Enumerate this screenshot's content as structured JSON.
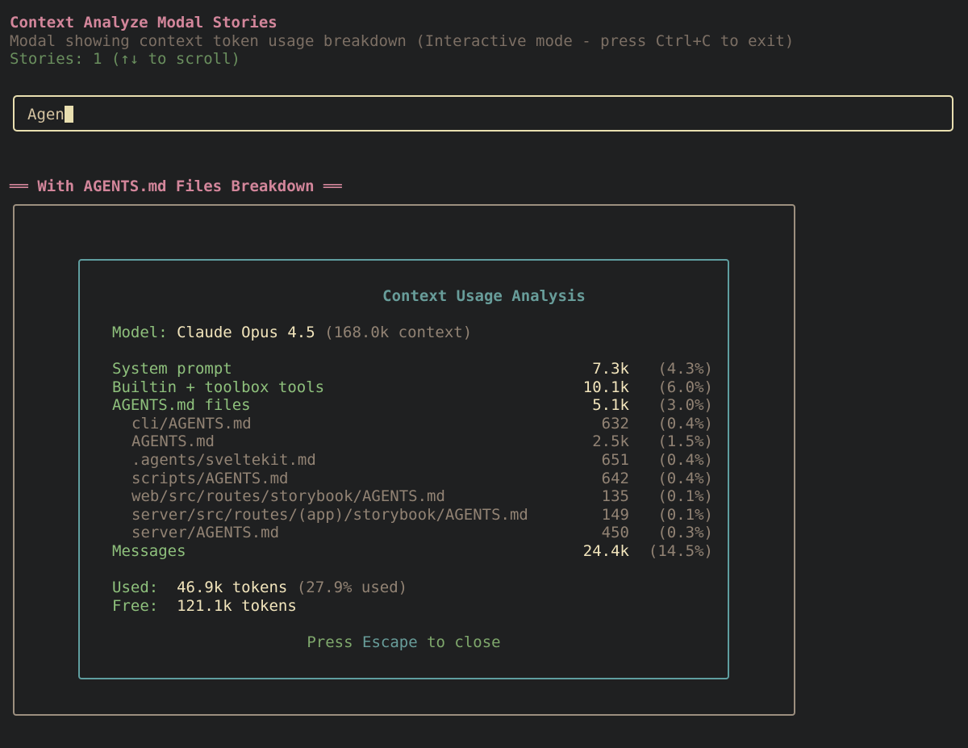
{
  "header": {
    "title": "Context Analyze Modal Stories",
    "subtitle": "Modal showing context token usage breakdown (Interactive mode - press Ctrl+C to exit)",
    "stories_line": "Stories: 1 (↑↓ to scroll)"
  },
  "search": {
    "value": "Agen"
  },
  "section": {
    "left_bars": "══",
    "title": "With AGENTS.md Files Breakdown",
    "right_bars": "══"
  },
  "modal": {
    "title": "Context Usage Analysis",
    "model_label": "Model:",
    "model_name": "Claude Opus 4.5",
    "model_context": "(168.0k context)",
    "rows": [
      {
        "label": "System prompt",
        "value": "7.3k",
        "pct": "(4.3%)",
        "kind": "main"
      },
      {
        "label": "Builtin + toolbox tools",
        "value": "10.1k",
        "pct": "(6.0%)",
        "kind": "main"
      },
      {
        "label": "AGENTS.md files",
        "value": "5.1k",
        "pct": "(3.0%)",
        "kind": "main"
      },
      {
        "label": "cli/AGENTS.md",
        "value": "632",
        "pct": "(0.4%)",
        "kind": "sub"
      },
      {
        "label": "AGENTS.md",
        "value": "2.5k",
        "pct": "(1.5%)",
        "kind": "sub"
      },
      {
        "label": ".agents/sveltekit.md",
        "value": "651",
        "pct": "(0.4%)",
        "kind": "sub"
      },
      {
        "label": "scripts/AGENTS.md",
        "value": "642",
        "pct": "(0.4%)",
        "kind": "sub"
      },
      {
        "label": "web/src/routes/storybook/AGENTS.md",
        "value": "135",
        "pct": "(0.1%)",
        "kind": "sub"
      },
      {
        "label": "server/src/routes/(app)/storybook/AGENTS.md",
        "value": "149",
        "pct": "(0.1%)",
        "kind": "sub"
      },
      {
        "label": "server/AGENTS.md",
        "value": "450",
        "pct": "(0.3%)",
        "kind": "sub"
      },
      {
        "label": "Messages",
        "value": "24.4k",
        "pct": "(14.5%)",
        "kind": "main"
      }
    ],
    "used_label": "Used:",
    "used_value": "46.9k tokens",
    "used_pct": "(27.9% used)",
    "free_label": "Free:",
    "free_value": "121.1k tokens",
    "footer_press": "Press",
    "footer_key": "Escape",
    "footer_rest": "to close"
  },
  "colors": {
    "background": "#1f2021",
    "title_pink": "#d3869b",
    "input_border": "#e9dfb0",
    "modal_border": "#5f9ea0",
    "label_green": "#8ec07c",
    "value_cream": "#f2e5bc",
    "muted": "#928374"
  }
}
